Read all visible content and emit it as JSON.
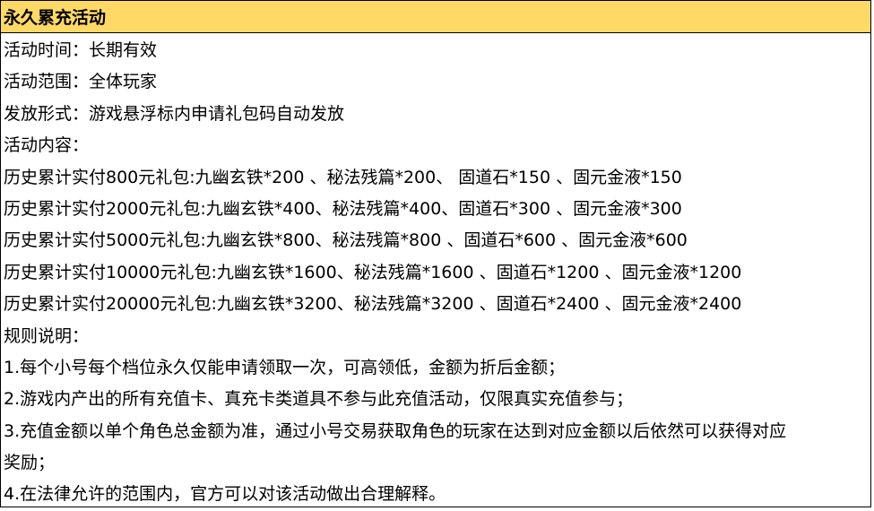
{
  "title": "永久累充活动",
  "lines": [
    "活动时间：长期有效",
    "活动范围：全体玩家",
    "发放形式：游戏悬浮标内申请礼包码自动发放",
    "活动内容：",
    "历史累计实付800元礼包:九幽玄铁*200 、秘法残篇*200、 固道石*150 、固元金液*150",
    "历史累计实付2000元礼包:九幽玄铁*400、秘法残篇*400、固道石*300 、固元金液*300",
    "历史累计实付5000元礼包:九幽玄铁*800、秘法残篇*800 、固道石*600 、固元金液*600",
    "历史累计实付10000元礼包:九幽玄铁*1600、秘法残篇*1600 、固道石*1200 、固元金液*1200",
    "历史累计实付20000元礼包:九幽玄铁*3200、秘法残篇*3200 、固道石*2400 、固元金液*2400",
    "规则说明：",
    "1.每个小号每个档位永久仅能申请领取一次，可高领低，金额为折后金额；",
    "2.游戏内产出的所有充值卡、真充卡类道具不参与此充值活动，仅限真实充值参与；",
    "3.充值金额以单个角色总金额为准，通过小号交易获取角色的玩家在达到对应金额以后依然可以获得对应",
    "奖励；",
    "4.在法律允许的范围内，官方可以对该活动做出合理解释。"
  ],
  "colors": {
    "header_bg": "#ffd966",
    "border": "#000000",
    "text": "#000000"
  }
}
